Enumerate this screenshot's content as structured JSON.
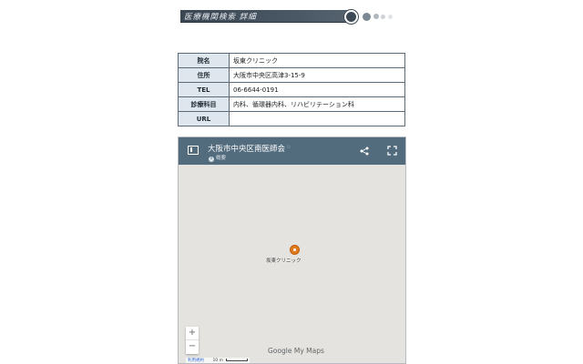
{
  "banner": {
    "title": "医療機関検索 詳細"
  },
  "clinic": {
    "rows": [
      {
        "label": "院名",
        "value": "坂東クリニック"
      },
      {
        "label": "住所",
        "value": "大阪市中央区高津3-15-9"
      },
      {
        "label": "TEL",
        "value": "06-6644-0191"
      },
      {
        "label": "診療科目",
        "value": "内科、循環器内科、リハビリテーション科"
      },
      {
        "label": "URL",
        "value": ""
      }
    ]
  },
  "map": {
    "title": "大阪市中央区南医師会",
    "subtitle": "概要",
    "marker_label": "坂東クリニック",
    "zoom_in": "+",
    "zoom_out": "−",
    "logo_google": "Google",
    "logo_suffix": "My Maps",
    "terms_link": "利用規約",
    "scale": "10 m",
    "colors": {
      "header": "#526b7d",
      "marker": "#e07a1f",
      "map_bg": "#e5e3df"
    }
  }
}
